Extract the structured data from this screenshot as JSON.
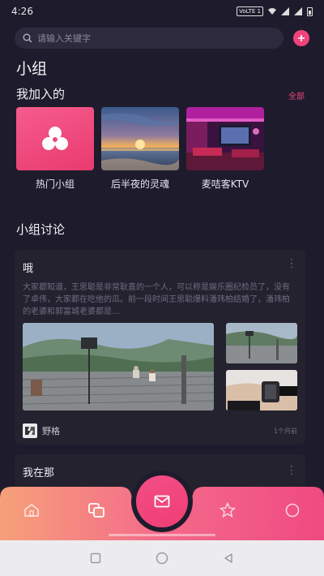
{
  "status": {
    "time": "4:26",
    "volte": "VoLTE 1"
  },
  "search": {
    "placeholder": "请输入关键字"
  },
  "page": {
    "title": "小组"
  },
  "joined": {
    "heading": "我加入的",
    "see_all": "全部",
    "groups": [
      {
        "label": "热门小组",
        "icon": "clover-icon"
      },
      {
        "label": "后半夜的灵魂",
        "icon": "sunset-photo"
      },
      {
        "label": "麦咭客KTV",
        "icon": "ktv-room-photo"
      }
    ]
  },
  "discussion": {
    "heading": "小组讨论",
    "posts": [
      {
        "title": "哦",
        "body": "大家都知道，王思聪是非常耿直的一个人，可以称是娱乐圈纪检员了，没有了卓伟，大家都在吃他的瓜。前一段时间王思聪爆料潘玮柏结婚了，潘玮柏的老婆和郭富城老婆都是…",
        "author": "野格",
        "time_ago": "1个月前"
      },
      {
        "title": "我在那"
      }
    ]
  },
  "tabbar": {
    "icons": [
      "home-icon",
      "groups-icon",
      "mail-icon",
      "star-icon",
      "profile-icon"
    ]
  },
  "colors": {
    "accent": "#f0437d",
    "background": "#1e1c2c",
    "card": "#24222f"
  }
}
